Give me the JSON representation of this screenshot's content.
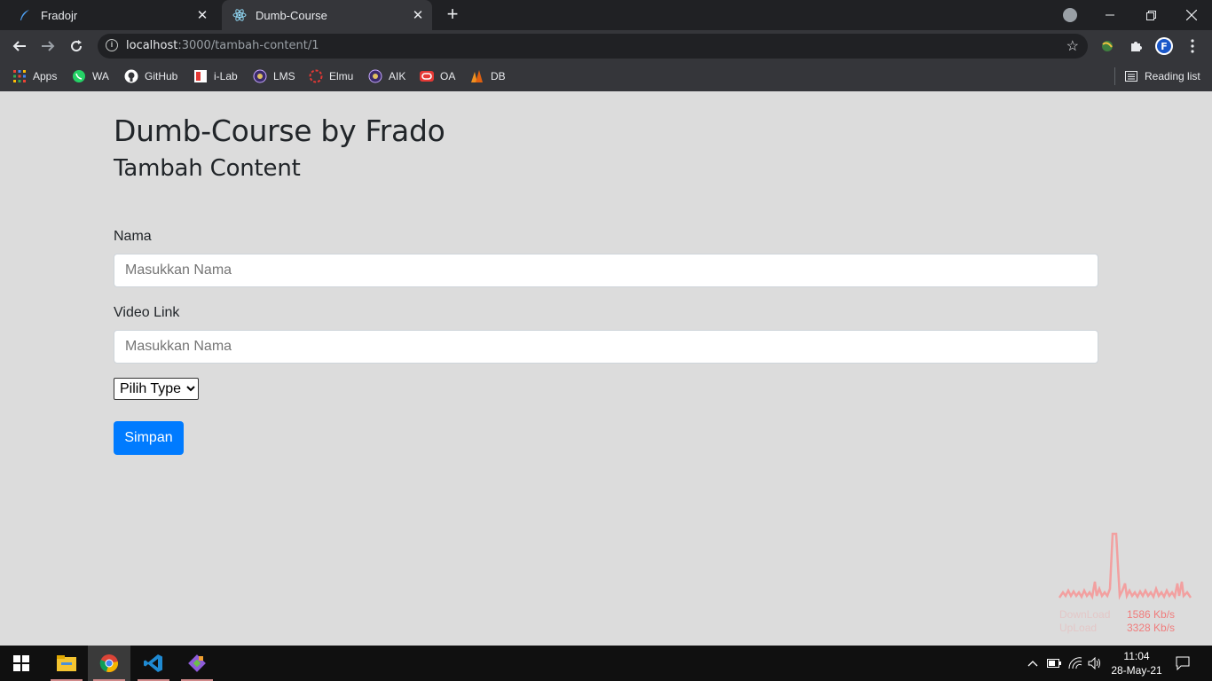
{
  "browser": {
    "tabs": [
      {
        "title": "Fradojr",
        "active": false
      },
      {
        "title": "Dumb-Course",
        "active": true
      }
    ],
    "new_tab_label": "+",
    "url_host": "localhost",
    "url_path": ":3000/tambah-content/1",
    "bookmarks": [
      {
        "label": "Apps",
        "icon": "apps-grid-icon"
      },
      {
        "label": "WA",
        "icon": "whatsapp-icon"
      },
      {
        "label": "GitHub",
        "icon": "github-icon"
      },
      {
        "label": "i-Lab",
        "icon": "ilab-icon"
      },
      {
        "label": "LMS",
        "icon": "lms-icon"
      },
      {
        "label": "Elmu",
        "icon": "elmu-icon"
      },
      {
        "label": "AIK",
        "icon": "aik-icon"
      },
      {
        "label": "OA",
        "icon": "oa-icon"
      },
      {
        "label": "DB",
        "icon": "db-icon"
      }
    ],
    "reading_list": "Reading list"
  },
  "page": {
    "title": "Dumb-Course by Frado",
    "subtitle": "Tambah Content",
    "form": {
      "nama_label": "Nama",
      "nama_placeholder": "Masukkan Nama",
      "video_label": "Video Link",
      "video_placeholder": "Masukkan Nama",
      "type_selected": "Pilih Type",
      "submit_label": "Simpan"
    }
  },
  "network_meter": {
    "download_label": "DownLoad",
    "download_value": "1586 Kb/s",
    "upload_label": "UpLoad",
    "upload_value": "3328 Kb/s"
  },
  "taskbar": {
    "time": "11:04",
    "date": "28-May-21"
  },
  "colors": {
    "accent": "#007bff",
    "page_bg": "#dcdcdc",
    "chrome_dark": "#202124",
    "chrome_toolbar": "#35363a"
  }
}
